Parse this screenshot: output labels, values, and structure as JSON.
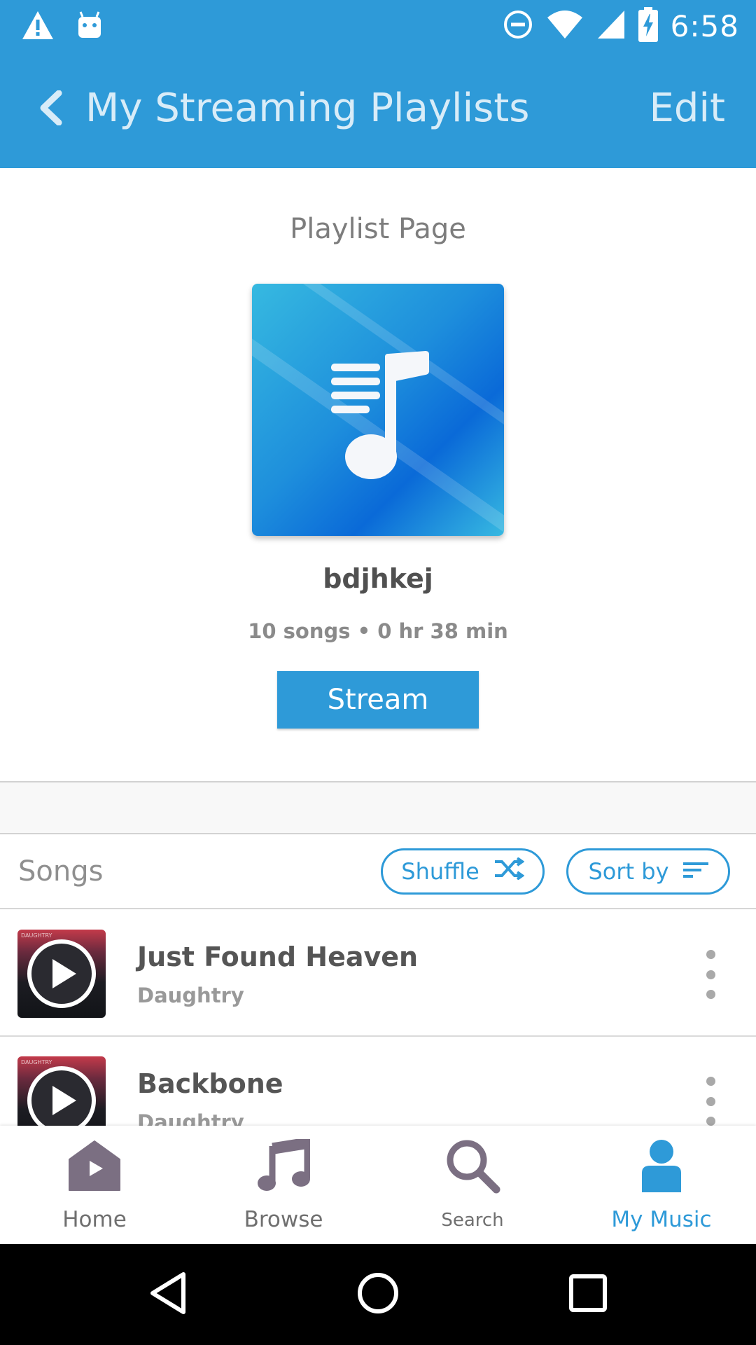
{
  "status_bar": {
    "time": "6:58",
    "icons": [
      "warning-icon",
      "android-icon",
      "do-not-disturb-icon",
      "wifi-icon",
      "cell-signal-icon",
      "battery-charging-icon"
    ]
  },
  "app_bar": {
    "title": "My Streaming Playlists",
    "edit_label": "Edit"
  },
  "header": {
    "page_label": "Playlist Page",
    "playlist_name": "bdjhkej",
    "meta": "10 songs • 0 hr 38 min",
    "stream_label": "Stream"
  },
  "songs": {
    "label": "Songs",
    "shuffle_label": "Shuffle",
    "sort_label": "Sort by",
    "items": [
      {
        "title": "Just Found Heaven",
        "artist": "Daughtry"
      },
      {
        "title": "Backbone",
        "artist": "Daughtry"
      }
    ]
  },
  "bottom_nav": {
    "items": [
      {
        "label": "Home",
        "icon": "home-icon",
        "active": false
      },
      {
        "label": "Browse",
        "icon": "music-note-icon",
        "active": false
      },
      {
        "label": "Search",
        "icon": "search-icon",
        "active": false
      },
      {
        "label": "My Music",
        "icon": "person-icon",
        "active": true
      }
    ]
  },
  "colors": {
    "accent": "#2e9ad8",
    "nav_inactive": "#7b6f82",
    "text_dark": "#505050"
  }
}
